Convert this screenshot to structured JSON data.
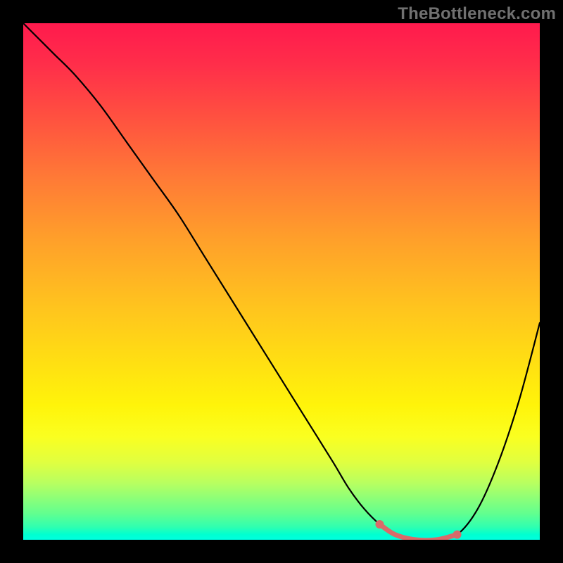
{
  "watermark": "TheBottleneck.com",
  "chart_data": {
    "type": "line",
    "title": "",
    "xlabel": "",
    "ylabel": "",
    "xlim": [
      0,
      100
    ],
    "ylim": [
      0,
      100
    ],
    "curve": {
      "x": [
        0,
        3,
        6,
        10,
        15,
        20,
        25,
        30,
        35,
        40,
        45,
        50,
        55,
        60,
        63,
        66,
        69,
        72,
        76,
        80,
        84,
        88,
        92,
        96,
        100
      ],
      "y": [
        100,
        97,
        94,
        90,
        84,
        77,
        70,
        63,
        55,
        47,
        39,
        31,
        23,
        15,
        10,
        6,
        3,
        1,
        0,
        0,
        1,
        6,
        15,
        27,
        42
      ]
    },
    "highlight_segment": {
      "x": [
        69,
        72,
        76,
        80,
        84
      ],
      "y": [
        3,
        1,
        0,
        0,
        1
      ],
      "color": "#d96a6a"
    },
    "highlight_dots": {
      "x": [
        69,
        84
      ],
      "y": [
        3,
        1
      ],
      "color": "#d96a6a"
    },
    "gradient_stops": [
      {
        "pos": 0,
        "color": "#ff1a4d"
      },
      {
        "pos": 50,
        "color": "#ffcc1a"
      },
      {
        "pos": 80,
        "color": "#f5ff30"
      },
      {
        "pos": 100,
        "color": "#00ffe0"
      }
    ]
  }
}
